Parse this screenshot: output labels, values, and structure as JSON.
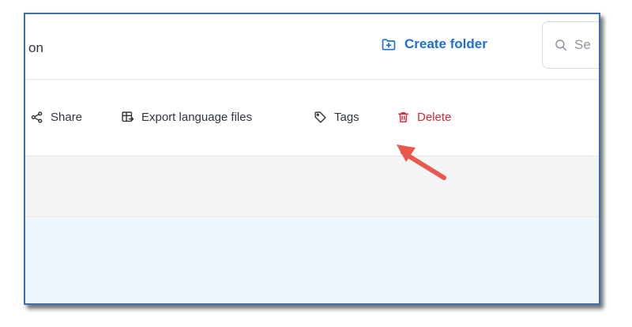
{
  "header": {
    "breadcrumb_text": "on",
    "create_folder_label": "Create folder",
    "create_folder_icon": "folder-plus-icon",
    "search_placeholder": "Se",
    "search_icon": "search-icon"
  },
  "toolbar": {
    "items": [
      {
        "label": "Share",
        "icon": "share-icon"
      },
      {
        "label": "Export language files",
        "icon": "export-table-icon"
      },
      {
        "label": "Tags",
        "icon": "tag-icon"
      },
      {
        "label": "Delete",
        "icon": "trash-icon",
        "color": "#d32a3a"
      }
    ]
  },
  "annotation": {
    "type": "arrow",
    "points_to": "Tags",
    "color": "#e9584a"
  },
  "colors": {
    "accent": "#1f6fd6",
    "danger": "#d32a3a",
    "frame_border": "#3c6fb6",
    "blue_band": "#eef7fd",
    "gray_band": "#f4f5f7"
  }
}
